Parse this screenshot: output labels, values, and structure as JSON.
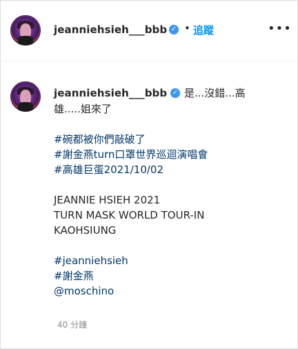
{
  "post": {
    "username": "jeanniehsieh___bbb",
    "follow_label": "追蹤",
    "separator": "•",
    "more_label": "•••"
  },
  "caption": {
    "username": "jeanniehsieh___bbb",
    "first_line": "是...沒錯...高",
    "line2": "雄.....姐來了",
    "hashtag1": "#碗都被你們敲破了",
    "hashtag2": "#謝金燕turn口罩世界巡迴演唱會",
    "hashtag3": "#高雄巨蛋2021/10/02",
    "text1": "JEANNIE HSIEH 2021",
    "text2": "TURN MASK WORLD TOUR-IN",
    "text3": "KAOHSIUNG",
    "hashtag4": "#jeanniehsieh",
    "hashtag5": "#謝金燕",
    "mention": "@moschino"
  },
  "timestamp": "40 分鐘",
  "colors": {
    "link": "#00376b",
    "follow": "#0095f6",
    "verified": "#3897f0",
    "muted": "#8e8e8e"
  },
  "icons": [
    "verified-badge-icon",
    "more-options-icon"
  ]
}
